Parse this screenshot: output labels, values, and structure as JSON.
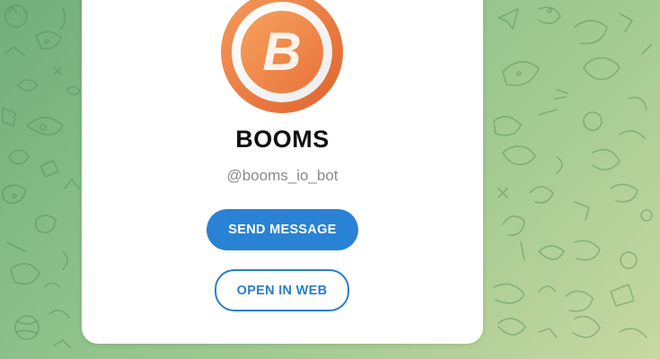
{
  "profile": {
    "name": "BOOMS",
    "handle": "@booms_io_bot",
    "logo_letter": "B"
  },
  "actions": {
    "send_label": "SEND MESSAGE",
    "web_label": "OPEN IN WEB"
  },
  "colors": {
    "accent": "#2a82d4",
    "logo_orange": "#e8763f",
    "background_green": "#8cc08a"
  },
  "icons": [
    "booms-logo-icon",
    "doodle-pattern"
  ]
}
